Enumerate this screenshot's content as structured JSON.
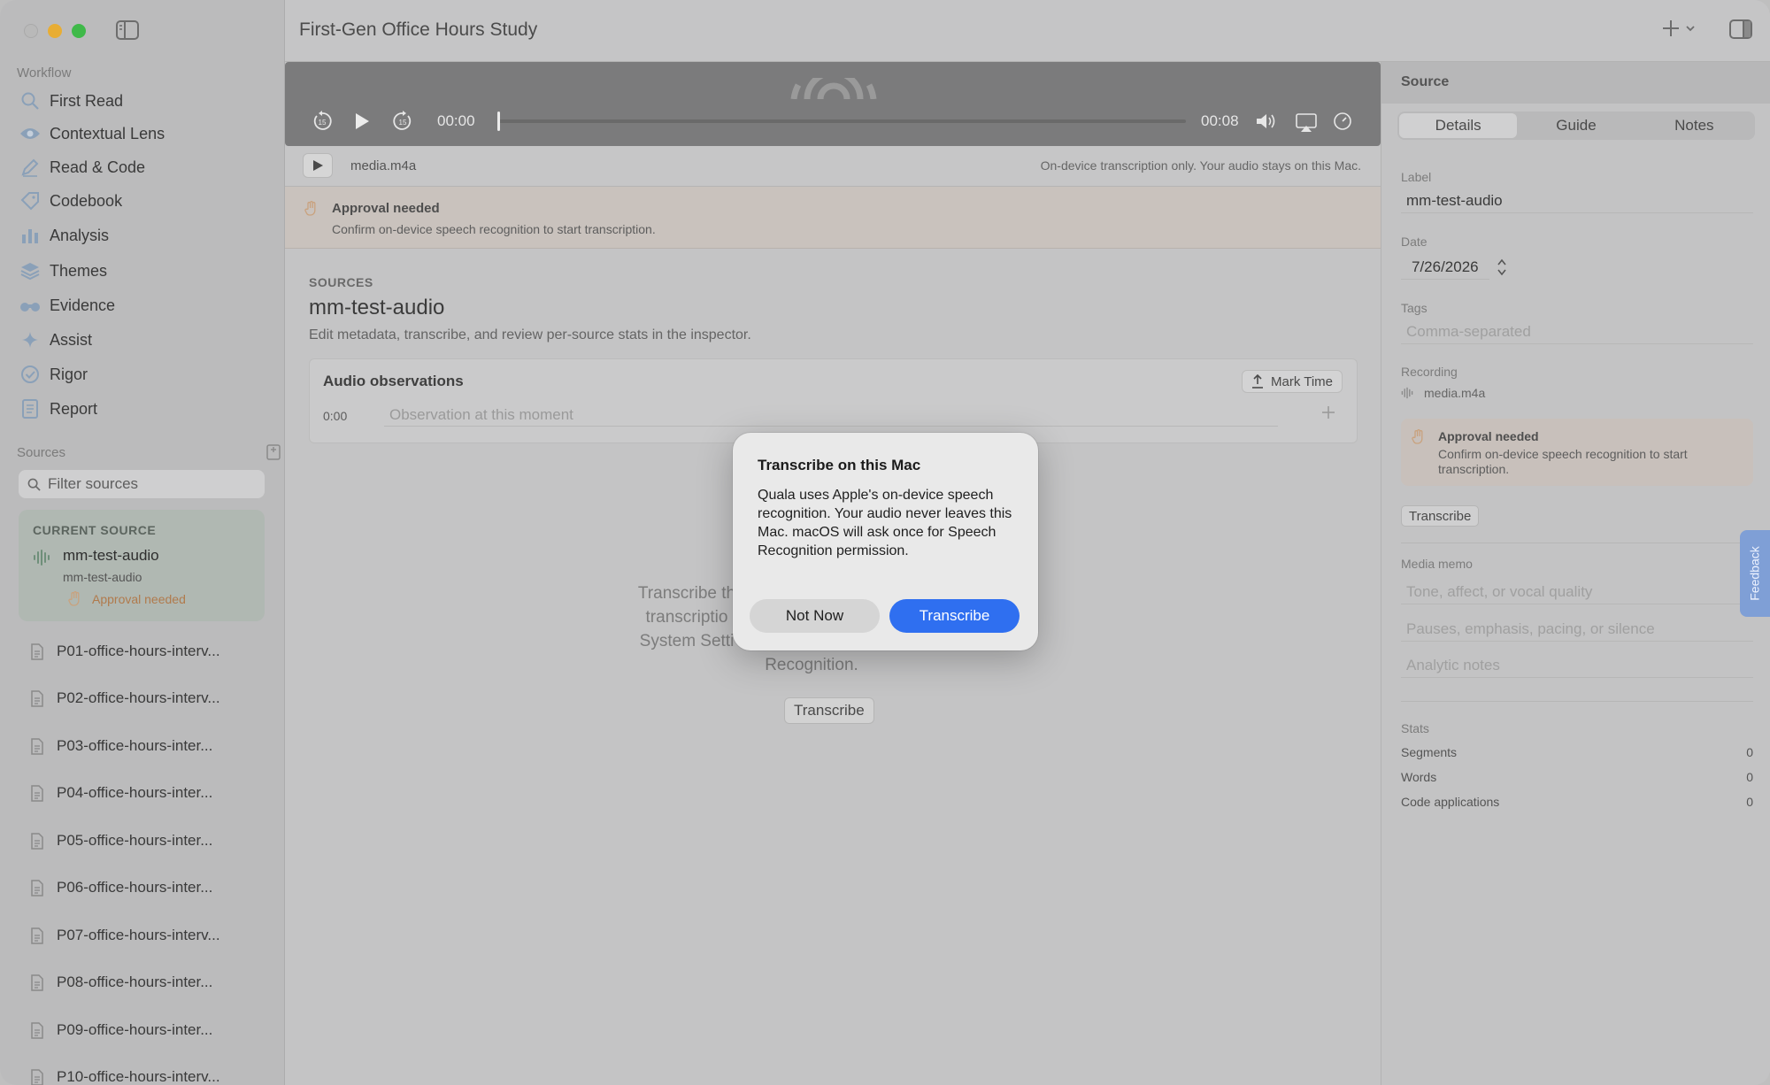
{
  "window": {
    "title": "First-Gen Office Hours Study"
  },
  "sidebar": {
    "workflow_label": "Workflow",
    "workflow_items": [
      {
        "label": "First Read",
        "icon": "magnifier-icon"
      },
      {
        "label": "Contextual Lens",
        "icon": "eye-icon"
      },
      {
        "label": "Read & Code",
        "icon": "pencil-icon"
      },
      {
        "label": "Codebook",
        "icon": "tag-icon"
      },
      {
        "label": "Analysis",
        "icon": "bar-chart-icon"
      },
      {
        "label": "Themes",
        "icon": "layers-icon"
      },
      {
        "label": "Evidence",
        "icon": "binoculars-icon"
      },
      {
        "label": "Assist",
        "icon": "sparkle-icon"
      },
      {
        "label": "Rigor",
        "icon": "check-seal-icon"
      },
      {
        "label": "Report",
        "icon": "document-icon"
      }
    ],
    "sources_label": "Sources",
    "filter_placeholder": "Filter sources",
    "current_source": {
      "caption": "CURRENT SOURCE",
      "name": "mm-test-audio",
      "subtitle": "mm-test-audio",
      "status": "Approval needed"
    },
    "files": [
      "P01-office-hours-interv...",
      "P02-office-hours-interv...",
      "P03-office-hours-inter...",
      "P04-office-hours-inter...",
      "P05-office-hours-inter...",
      "P06-office-hours-inter...",
      "P07-office-hours-interv...",
      "P08-office-hours-inter...",
      "P09-office-hours-inter...",
      "P10-office-hours-interv..."
    ]
  },
  "player": {
    "current_time": "00:00",
    "duration": "00:08",
    "progress": 0
  },
  "file_bar": {
    "filename": "media.m4a",
    "note": "On-device transcription only. Your audio stays on this Mac."
  },
  "banner": {
    "title": "Approval needed",
    "message": "Confirm on-device speech recognition to start transcription."
  },
  "main": {
    "caption": "SOURCES",
    "title": "mm-test-audio",
    "description": "Edit metadata, transcribe, and review per-source stats in the inspector.",
    "observations": {
      "heading": "Audio observations",
      "mark_time": "Mark Time",
      "time": "0:00",
      "placeholder": "Observation at this moment"
    },
    "empty": {
      "line1": "Transcribe th",
      "line2": "transcriptio",
      "line3": "System Setti",
      "line4": "Recognition.",
      "button": "Transcribe"
    }
  },
  "inspector": {
    "header": "Source",
    "tabs": [
      "Details",
      "Guide",
      "Notes"
    ],
    "active_tab": "Details",
    "label_caption": "Label",
    "label_value": "mm-test-audio",
    "date_caption": "Date",
    "date_value": "7/26/2026",
    "tags_caption": "Tags",
    "tags_placeholder": "Comma-separated",
    "recording_caption": "Recording",
    "recording_file": "media.m4a",
    "approval_title": "Approval needed",
    "approval_message": "Confirm on-device speech recognition to start transcription.",
    "transcribe_button": "Transcribe",
    "memo_caption": "Media memo",
    "memo_placeholders": [
      "Tone, affect, or vocal quality",
      "Pauses, emphasis, pacing, or silence",
      "Analytic notes"
    ],
    "stats_caption": "Stats",
    "stats": [
      {
        "label": "Segments",
        "value": "0"
      },
      {
        "label": "Words",
        "value": "0"
      },
      {
        "label": "Code applications",
        "value": "0"
      }
    ]
  },
  "feedback_tab": "Feedback",
  "dialog": {
    "title": "Transcribe on this Mac",
    "body": "Quala uses Apple's on-device speech recognition. Your audio never leaves this Mac. macOS will ask once for Speech Recognition permission.",
    "secondary_button": "Not Now",
    "primary_button": "Transcribe"
  },
  "colors": {
    "accent": "#2f6ff0",
    "approval": "#b07a4c",
    "traffic_min": "#e8ad34",
    "traffic_max": "#3fb949"
  }
}
